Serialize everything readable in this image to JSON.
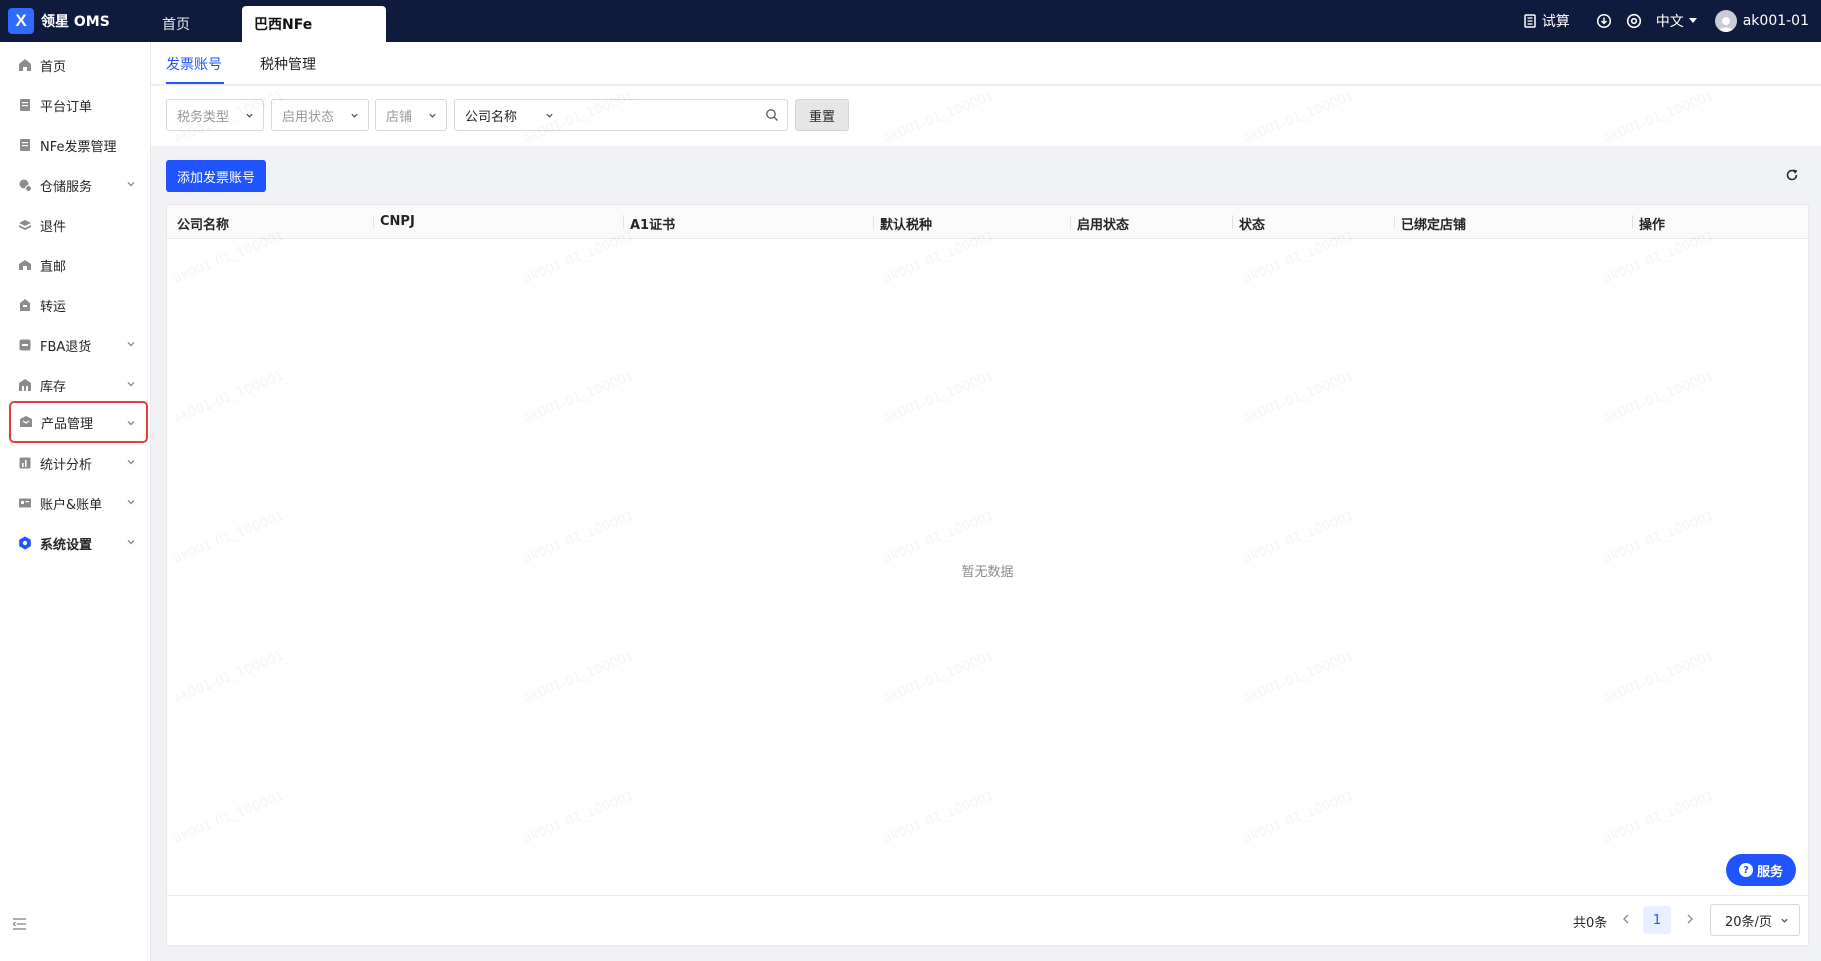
{
  "app": {
    "brand_mark": "X",
    "brand_name": "领星 OMS"
  },
  "topbar": {
    "tabs": [
      {
        "label": "首页"
      },
      {
        "label": "巴西NFe"
      }
    ],
    "calc_label": "试算",
    "lang_label": "中文",
    "user_label": "ak001-01"
  },
  "sidebar": {
    "items": [
      {
        "label": "首页",
        "icon": "home-icon"
      },
      {
        "label": "平台订单",
        "icon": "clipboard-icon"
      },
      {
        "label": "NFe发票管理",
        "icon": "clipboard-icon"
      },
      {
        "label": "仓储服务",
        "icon": "warehouse-service-icon"
      },
      {
        "label": "退件",
        "icon": "return-icon"
      },
      {
        "label": "直邮",
        "icon": "direct-mail-icon"
      },
      {
        "label": "转运",
        "icon": "transfer-icon"
      },
      {
        "label": "FBA退货",
        "icon": "fba-icon"
      },
      {
        "label": "库存",
        "icon": "inventory-icon"
      },
      {
        "label": "产品管理",
        "icon": "product-icon"
      },
      {
        "label": "统计分析",
        "icon": "stats-icon"
      },
      {
        "label": "账户&账单",
        "icon": "account-icon"
      },
      {
        "label": "系统设置",
        "icon": "settings-icon"
      }
    ]
  },
  "subtabs": [
    {
      "label": "发票账号"
    },
    {
      "label": "税种管理"
    }
  ],
  "filters": {
    "tax_type": "税务类型",
    "enable_status": "启用状态",
    "store": "店铺",
    "search_field": "公司名称",
    "search_value": "",
    "reset_label": "重置"
  },
  "actions": {
    "add_label": "添加发票账号"
  },
  "table": {
    "columns": [
      "公司名称",
      "CNPJ",
      "A1证书",
      "默认税种",
      "启用状态",
      "状态",
      "已绑定店铺",
      "操作"
    ],
    "rows": [],
    "empty_text": "暂无数据"
  },
  "pagination": {
    "total_label": "共0条",
    "current_page": "1",
    "page_size_label": "20条/页"
  },
  "service_label": "服务",
  "watermark_text": "ak001-01_100001",
  "colors": {
    "topbar": "#0f1b3d",
    "primary": "#1f54ff",
    "highlight_border": "#e53e3e"
  }
}
